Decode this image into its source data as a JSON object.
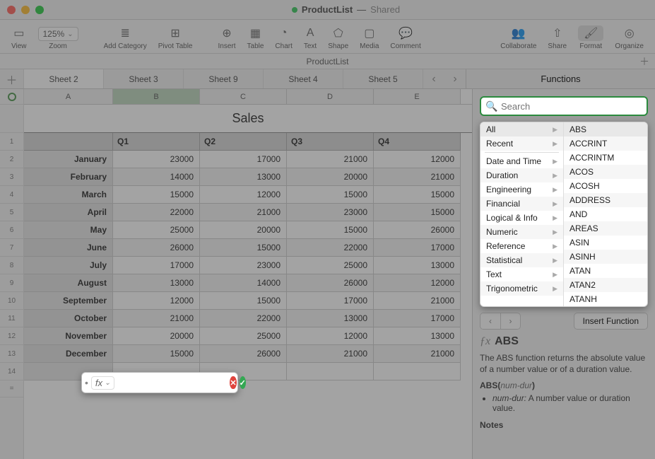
{
  "window": {
    "title": "ProductList",
    "shared_label": "Shared"
  },
  "toolbar": {
    "view": "View",
    "zoom": "Zoom",
    "zoom_value": "125%",
    "add_category": "Add Category",
    "pivot_table": "Pivot Table",
    "insert": "Insert",
    "table": "Table",
    "chart": "Chart",
    "text": "Text",
    "shape": "Shape",
    "media": "Media",
    "comment": "Comment",
    "collaborate": "Collaborate",
    "share": "Share",
    "format": "Format",
    "organize": "Organize"
  },
  "sheet_label": "ProductList",
  "tabs": [
    "Sheet 2",
    "Sheet 3",
    "Sheet 9",
    "Sheet 4",
    "Sheet 5"
  ],
  "panel_title": "Functions",
  "columns": [
    "A",
    "B",
    "C",
    "D",
    "E"
  ],
  "row_numbers": [
    "1",
    "2",
    "3",
    "4",
    "5",
    "6",
    "7",
    "8",
    "9",
    "10",
    "11",
    "12",
    "13",
    "14"
  ],
  "equals_label": "=",
  "table": {
    "title": "Sales",
    "headers": [
      "",
      "Q1",
      "Q2",
      "Q3",
      "Q4"
    ],
    "rows": [
      {
        "label": "January",
        "v": [
          "23000",
          "17000",
          "21000",
          "12000"
        ]
      },
      {
        "label": "February",
        "v": [
          "14000",
          "13000",
          "20000",
          "21000"
        ]
      },
      {
        "label": "March",
        "v": [
          "15000",
          "12000",
          "15000",
          "15000"
        ]
      },
      {
        "label": "April",
        "v": [
          "22000",
          "21000",
          "23000",
          "15000"
        ]
      },
      {
        "label": "May",
        "v": [
          "25000",
          "20000",
          "15000",
          "26000"
        ]
      },
      {
        "label": "June",
        "v": [
          "26000",
          "15000",
          "22000",
          "17000"
        ]
      },
      {
        "label": "July",
        "v": [
          "17000",
          "23000",
          "25000",
          "13000"
        ]
      },
      {
        "label": "August",
        "v": [
          "13000",
          "14000",
          "26000",
          "12000"
        ]
      },
      {
        "label": "September",
        "v": [
          "12000",
          "15000",
          "17000",
          "21000"
        ]
      },
      {
        "label": "October",
        "v": [
          "21000",
          "22000",
          "13000",
          "17000"
        ]
      },
      {
        "label": "November",
        "v": [
          "20000",
          "25000",
          "12000",
          "13000"
        ]
      },
      {
        "label": "December",
        "v": [
          "15000",
          "26000",
          "21000",
          "21000"
        ]
      }
    ]
  },
  "formula": {
    "fx_label": "fx",
    "value": "",
    "cancel": "✕",
    "ok": "✓"
  },
  "search": {
    "placeholder": "Search"
  },
  "fn_categories": [
    "All",
    "Recent",
    "Date and Time",
    "Duration",
    "Engineering",
    "Financial",
    "Logical & Info",
    "Numeric",
    "Reference",
    "Statistical",
    "Text",
    "Trigonometric"
  ],
  "fn_list": [
    "ABS",
    "ACCRINT",
    "ACCRINTM",
    "ACOS",
    "ACOSH",
    "ADDRESS",
    "AND",
    "AREAS",
    "ASIN",
    "ASINH",
    "ATAN",
    "ATAN2",
    "ATANH"
  ],
  "insert_fn_label": "Insert Function",
  "help": {
    "name": "ABS",
    "desc": "The ABS function returns the absolute value of a number value or of a duration value.",
    "sig_name": "ABS",
    "sig_arg": "num-dur",
    "arg_name": "num-dur:",
    "arg_desc": "A number value or duration value.",
    "notes_label": "Notes"
  }
}
